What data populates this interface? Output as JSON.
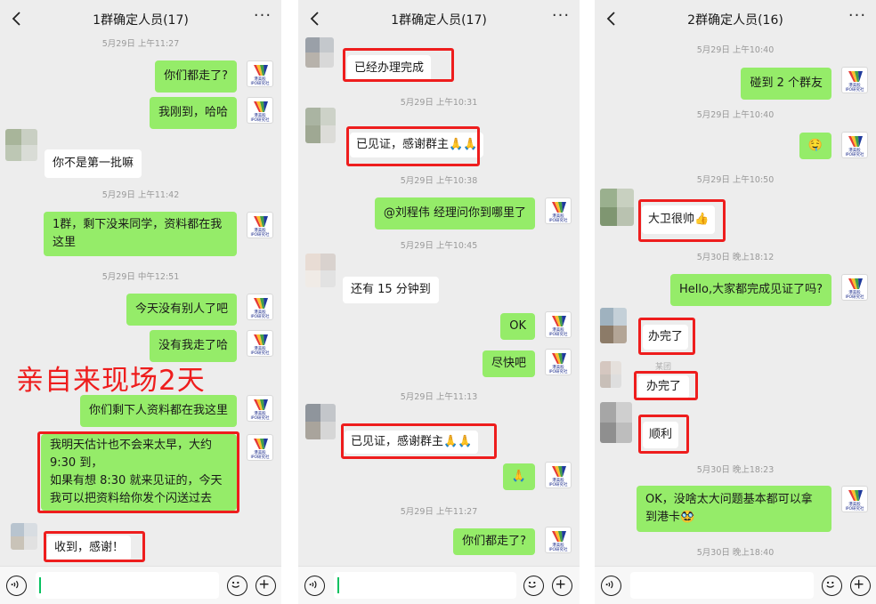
{
  "panels": [
    {
      "title": "1群确定人员(17)",
      "ts": [
        "5月29日 上午11:27",
        "5月29日 上午11:42",
        "5月29日 中午12:51"
      ],
      "msgs": [
        "你们都走了?",
        "我刚到，哈哈",
        "你不是第一批嘛",
        "1群，剩下没来同学，资料都在我这里",
        "今天没有别人了吧",
        "没有我走了哈",
        "你们剩下人资料都在我这里",
        "我明天估计也不会来太早，大约 9:30 到，",
        "如果有想 8:30 就来见证的，今天我可以把资料给你发个闪送过去",
        "收到，感谢！"
      ]
    },
    {
      "title": "1群确定人员(17)",
      "ts": [
        "5月29日 上午10:31",
        "5月29日 上午10:38",
        "5月29日 上午10:45",
        "5月29日 上午11:13",
        "5月29日 上午11:27"
      ],
      "msgs": [
        "已经办理完成",
        "已见证，感谢群主🙏🙏",
        "@刘程伟  经理问你到哪里了",
        "还有 15 分钟到",
        "OK",
        "尽快吧",
        "已见证，感谢群主🙏🙏",
        "🙏",
        "你们都走了?"
      ]
    },
    {
      "title": "2群确定人员(16)",
      "ts": [
        "5月29日 上午10:40",
        "5月29日 上午10:40",
        "5月29日 上午10:50",
        "5月30日 晚上18:12",
        "5月30日 晚上18:23",
        "5月30日 晚上18:40"
      ],
      "msgs": [
        "碰到 2 个群友",
        "🤤",
        "大卫很帅👍",
        "Hello,大家都完成见证了吗?",
        "办完了",
        "办完了",
        "顺利",
        "OK，没啥太大问题基本都可以拿到港卡🥸"
      ],
      "sender": "某团"
    }
  ],
  "avatar_text": "港美股\nIPO研究社",
  "overlay": "亲自来现场2天",
  "colors": {
    "bg": "#ededed",
    "me_bubble": "#95ec69",
    "them_bubble": "#ffffff",
    "highlight": "#ee1d1d",
    "caret": "#07c160"
  },
  "icons": [
    "back-chevron-icon",
    "more-dots-icon",
    "voice-icon",
    "emoji-icon",
    "plus-icon"
  ]
}
